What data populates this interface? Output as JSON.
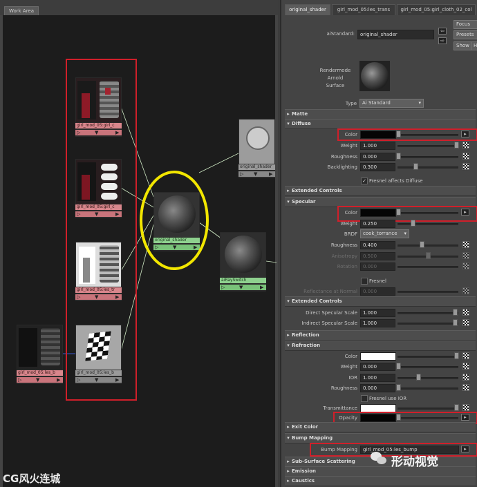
{
  "workarea": {
    "tab_label": "Work Area",
    "nodes": {
      "tex1": "girl_mod_05:girl_c",
      "tex2": "girl_mod_05:girl_c",
      "tex3": "girl_mod_05:les_tr",
      "bump_file": "girl_mod_05:les_b",
      "bump2d": "girl_mod_05:les_b",
      "shader": "original_shader",
      "sg": "original_shader",
      "switch": "aiRaySwitch"
    },
    "watermark_left": "CG风火连城",
    "watermark_right": "形动视觉",
    "colors": {
      "red_box": "#d01f2a",
      "yellow_circle": "#f2e600"
    }
  },
  "ae": {
    "tabs": [
      "original_shader",
      "girl_mod_05:les_trans",
      "girl_mod_05:girl_cloth_02_col"
    ],
    "shader_type_label": "aiStandard:",
    "shader_name": "original_shader",
    "buttons": {
      "focus": "Focus",
      "presets": "Presets",
      "show": "Show",
      "hide": "Hide"
    },
    "swatch_caption": [
      "Rendermode",
      "Arnold",
      "Surface"
    ],
    "type_label": "Type",
    "type_value": "Ai Standard",
    "sections": {
      "matte": "Matte",
      "diffuse": "Diffuse",
      "extended1": "Extended Controls",
      "specular": "Specular",
      "extended2": "Extended Controls",
      "reflection": "Reflection",
      "refraction": "Refraction",
      "exit_color": "Exit Color",
      "bump": "Bump Mapping",
      "sss": "Sub-Surface Scattering",
      "emission": "Emission",
      "caustics": "Caustics"
    },
    "diffuse": {
      "color_label": "Color",
      "weight_label": "Weight",
      "weight": "1.000",
      "weight_level": 1.0,
      "roughness_label": "Roughness",
      "roughness": "0.000",
      "roughness_level": 0.0,
      "backlighting_label": "Backlighting",
      "backlighting": "0.300",
      "backlighting_level": 0.3,
      "fresnel_label": "Fresnel affects Diffuse"
    },
    "specular": {
      "color_label": "Color",
      "weight_label": "Weight",
      "weight": "0.250",
      "weight_level": 0.25,
      "brdf_label": "BRDF",
      "brdf": "cook_torrance",
      "roughness_label": "Roughness",
      "roughness": "0.400",
      "roughness_level": 0.4,
      "anisotropy_label": "Anisotropy",
      "anisotropy": "0.500",
      "anisotropy_level": 0.5,
      "rotation_label": "Rotation",
      "rotation": "0.000",
      "rotation_level": 0.0,
      "fresnel_label": "Fresnel",
      "refl_normal_label": "Reflectance at Normal",
      "refl_normal": "0.000"
    },
    "extended2": {
      "direct_label": "Direct Specular Scale",
      "direct": "1.000",
      "indirect_label": "Indirect Specular Scale",
      "indirect": "1.000"
    },
    "refraction": {
      "color_label": "Color",
      "weight_label": "Weight",
      "weight": "0.000",
      "ior_label": "IOR",
      "ior": "1.000",
      "roughness_label": "Roughness",
      "roughness": "0.000",
      "fresnel_ior_label": "Fresnel use IOR",
      "transmittance_label": "Transmittance",
      "opacity_label": "Opacity"
    },
    "bump": {
      "label": "Bump Mapping",
      "value": "girl_mod_05:les_bump"
    }
  }
}
